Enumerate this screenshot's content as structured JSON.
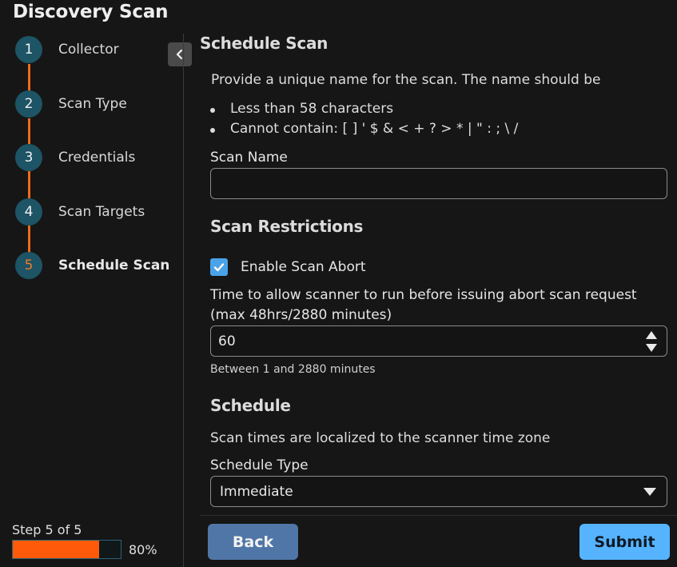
{
  "window": {
    "title": "Discovery Scan"
  },
  "steps": [
    {
      "number": "1",
      "label": "Collector"
    },
    {
      "number": "2",
      "label": "Scan Type"
    },
    {
      "number": "3",
      "label": "Credentials"
    },
    {
      "number": "4",
      "label": "Scan Targets"
    },
    {
      "number": "5",
      "label": "Schedule Scan",
      "active": true
    }
  ],
  "progress": {
    "step_text": "Step 5 of 5",
    "percent_text": "80%",
    "value": 0.8
  },
  "form": {
    "heading": "Schedule Scan",
    "intro": "Provide a unique name for the scan. The name should be",
    "rules": [
      "Less than 58 characters",
      "Cannot contain: [ ] ' $ & < + ? > * | \" : ; \\ /"
    ],
    "scan_name": {
      "label": "Scan Name",
      "value": ""
    },
    "restrictions": {
      "heading": "Scan Restrictions",
      "enable_abort_label": "Enable Scan Abort",
      "enable_abort_checked": true,
      "time_label_line1": "Time to allow scanner to run before issuing abort scan request",
      "time_label_line2": "(max 48hrs/2880 minutes)",
      "time_value": "60",
      "time_hint": "Between 1 and 2880 minutes"
    },
    "schedule": {
      "heading": "Schedule",
      "note": "Scan times are localized to the scanner time zone",
      "type_label": "Schedule Type",
      "type_value": "Immediate"
    }
  },
  "buttons": {
    "back": "Back",
    "submit": "Submit"
  },
  "icons": {
    "collapse": "chevron-left-icon",
    "checkbox": "checkmark-icon",
    "spinner": "spinner-arrows-icon",
    "dropdown": "caret-down-icon"
  },
  "colors": {
    "accent_orange": "#f06a1a",
    "step_circle": "#1d5466",
    "checkbox": "#4aa3e8",
    "back_button": "#4f76a6",
    "submit_button": "#56b4ff"
  }
}
